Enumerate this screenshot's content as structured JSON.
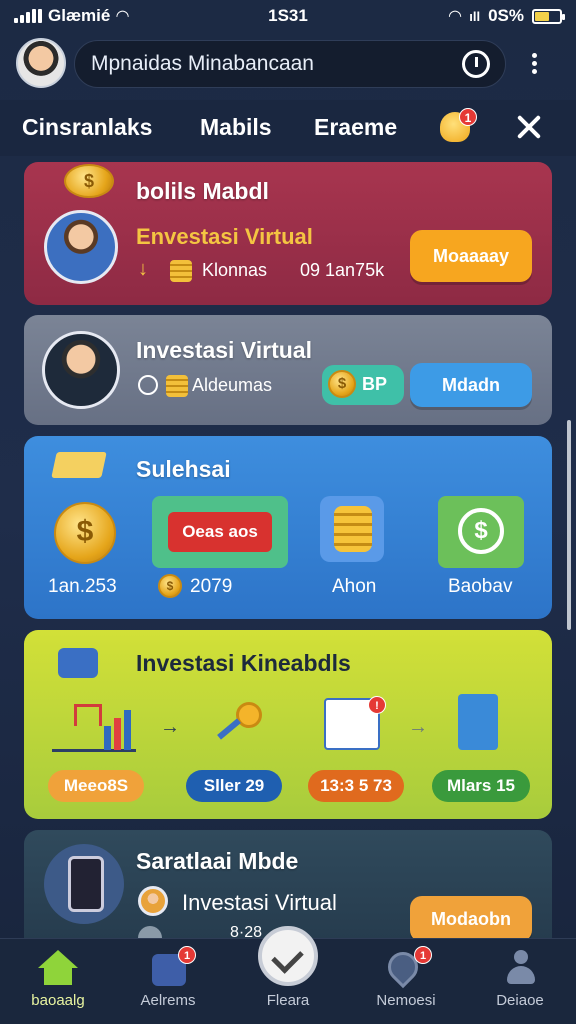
{
  "status_bar": {
    "carrier": "Glæmié",
    "time": "1S31",
    "battery": "0S%",
    "battery_level": 0.6
  },
  "search": {
    "text": "Mpnaidas Minabancaan"
  },
  "tabs": [
    {
      "label": "Cinsranlaks"
    },
    {
      "label": "Mabils"
    },
    {
      "label": "Eraeme"
    }
  ],
  "notification_count": "1",
  "cards": {
    "card1": {
      "title": "bolils Mabdl",
      "subtitle": "Envestasi Virtual",
      "meta_left": "Klonnas",
      "meta_right": "09 1an75k",
      "button": "Moaaaay"
    },
    "card2": {
      "title": "Investasi Virtual",
      "meta": "Aldeumas",
      "badge": "BP",
      "button": "Mdadn"
    },
    "card3": {
      "title": "Sulehsai",
      "items": [
        {
          "label": "1an.253"
        },
        {
          "label": "2079",
          "banner": "Oeas aos"
        },
        {
          "label": "Ahon"
        },
        {
          "label": "Baobav"
        }
      ]
    },
    "card4": {
      "title": "Investasi Kineabdls",
      "pills": [
        {
          "label": "Meeo8S",
          "color": "#f0a23a"
        },
        {
          "label": "Sller 29",
          "color": "#1f5fb0"
        },
        {
          "label": "13:3 5 73",
          "color": "#e06a1e"
        },
        {
          "label": "Mlars 15",
          "color": "#3a9a3c"
        }
      ]
    },
    "card5": {
      "title": "Saratlaai Mbde",
      "subtitle": "Investasi Virtual",
      "meta": "8·28",
      "button": "Modaobn"
    }
  },
  "bottom_nav": [
    {
      "label": "baoaalg",
      "icon": "home-icon",
      "active": true
    },
    {
      "label": "Aelrems",
      "icon": "apps-icon",
      "badge": "1"
    },
    {
      "label": "Fleara",
      "icon": "check-icon"
    },
    {
      "label": "Nemoesi",
      "icon": "location-icon",
      "badge": "1"
    },
    {
      "label": "Deiaoe",
      "icon": "profile-icon"
    }
  ]
}
